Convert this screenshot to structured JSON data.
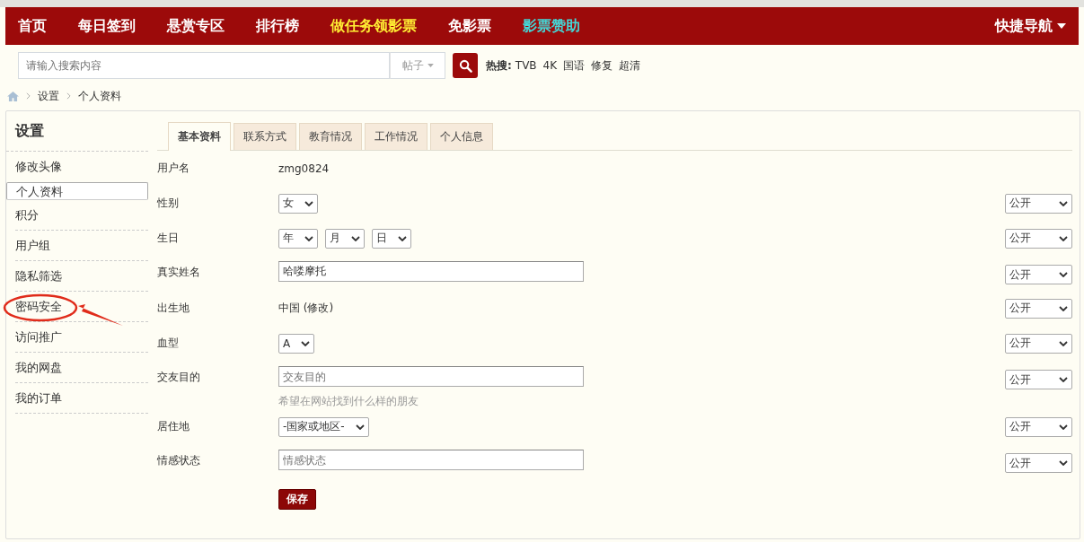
{
  "nav": {
    "items": [
      {
        "label": "首页",
        "color": "#ffffff"
      },
      {
        "label": "每日签到",
        "color": "#ffffff"
      },
      {
        "label": "悬赏专区",
        "color": "#ffffff"
      },
      {
        "label": "排行榜",
        "color": "#ffffff"
      },
      {
        "label": "做任务领影票",
        "color": "#ffee33"
      },
      {
        "label": "免影票",
        "color": "#ffffff"
      },
      {
        "label": "影票赞助",
        "color": "#44d6d6"
      }
    ],
    "quick_nav": "快捷导航"
  },
  "search": {
    "placeholder": "请输入搜索内容",
    "scope": "帖子",
    "hot_label": "热搜:",
    "hot_terms": [
      "TVB",
      "4K",
      "国语",
      "修复",
      "超清"
    ]
  },
  "breadcrumb": [
    "设置",
    "个人资料"
  ],
  "sidebar": {
    "title": "设置",
    "items": [
      {
        "label": "修改头像",
        "selected": false,
        "circled": false
      },
      {
        "label": "个人资料",
        "selected": true,
        "circled": false
      },
      {
        "label": "积分",
        "selected": false,
        "circled": false
      },
      {
        "label": "用户组",
        "selected": false,
        "circled": false
      },
      {
        "label": "隐私筛选",
        "selected": false,
        "circled": false
      },
      {
        "label": "密码安全",
        "selected": false,
        "circled": true
      },
      {
        "label": "访问推广",
        "selected": false,
        "circled": false
      },
      {
        "label": "我的网盘",
        "selected": false,
        "circled": false
      },
      {
        "label": "我的订单",
        "selected": false,
        "circled": false
      }
    ]
  },
  "tabs": [
    {
      "label": "基本资料",
      "selected": true
    },
    {
      "label": "联系方式",
      "selected": false
    },
    {
      "label": "教育情况",
      "selected": false
    },
    {
      "label": "工作情况",
      "selected": false
    },
    {
      "label": "个人信息",
      "selected": false
    }
  ],
  "form": [
    {
      "kind": "text",
      "label": "用户名",
      "value": "zmg0824"
    },
    {
      "kind": "selects",
      "label": "性别",
      "selects": [
        "女"
      ],
      "privacy": "公开"
    },
    {
      "kind": "selects",
      "label": "生日",
      "selects": [
        "年",
        "月",
        "日"
      ],
      "privacy": "公开"
    },
    {
      "kind": "input",
      "label": "真实姓名",
      "value": "哈喽摩托",
      "privacy": "公开"
    },
    {
      "kind": "text",
      "label": "出生地",
      "value": "中国 (修改)",
      "privacy": "公开"
    },
    {
      "kind": "selects",
      "label": "血型",
      "selects": [
        "A"
      ],
      "privacy": "公开"
    },
    {
      "kind": "input",
      "label": "交友目的",
      "placeholder": "交友目的",
      "hint": "希望在网站找到什么样的朋友",
      "privacy": "公开"
    },
    {
      "kind": "selects",
      "label": "居住地",
      "selects": [
        "-国家或地区-"
      ],
      "privacy": "公开"
    },
    {
      "kind": "input",
      "label": "情感状态",
      "placeholder": "情感状态",
      "privacy": "公开"
    }
  ],
  "save_button": "保存"
}
